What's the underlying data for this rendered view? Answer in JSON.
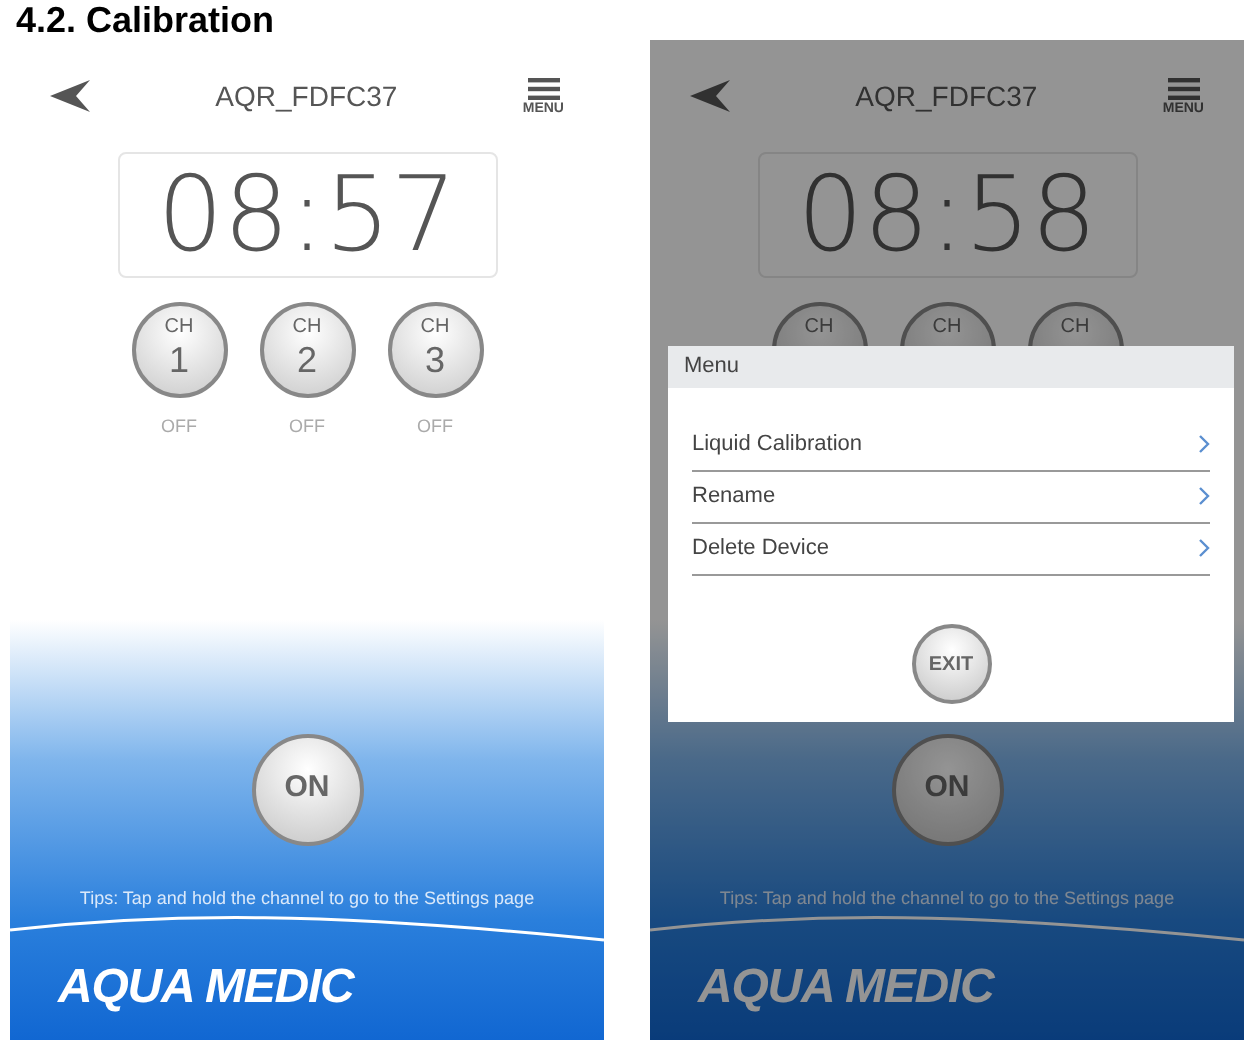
{
  "heading": "4.2. Calibration",
  "screens": [
    {
      "title": "AQR_FDFC37",
      "menu_label": "MENU",
      "clock": "08:57",
      "dimmed": false,
      "channels": [
        {
          "label": "CH",
          "number": "1",
          "status": "OFF"
        },
        {
          "label": "CH",
          "number": "2",
          "status": "OFF"
        },
        {
          "label": "CH",
          "number": "3",
          "status": "OFF"
        }
      ],
      "power_button": "ON",
      "tips": "Tips: Tap and hold the channel to go to the Settings page",
      "logo": "AQUA MEDIC"
    },
    {
      "title": "AQR_FDFC37",
      "menu_label": "MENU",
      "clock": "08:58",
      "dimmed": true,
      "channels": [
        {
          "label": "CH"
        },
        {
          "label": "CH"
        },
        {
          "label": "CH"
        }
      ],
      "power_button": "ON",
      "tips": "Tips: Tap and hold the channel to go to the Settings page",
      "logo": "AQUA MEDIC",
      "menu": {
        "title": "Menu",
        "items": [
          "Liquid Calibration",
          "Rename",
          "Delete Device"
        ],
        "exit_button": "EXIT"
      }
    }
  ]
}
